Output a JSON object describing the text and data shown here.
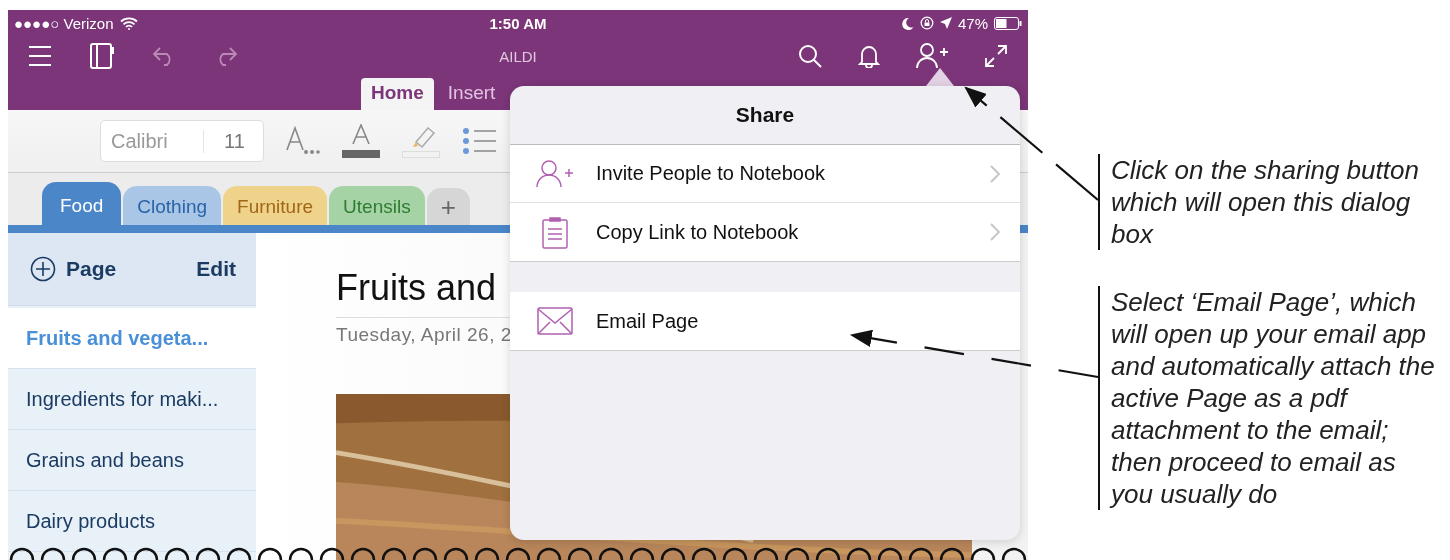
{
  "status_bar": {
    "carrier": "●●●●○ Verizon",
    "time": "1:50 AM",
    "battery": "47%"
  },
  "app_bar": {
    "title": "AILDI",
    "history": [
      {
        "kind": "undo",
        "disabled": true
      },
      {
        "kind": "redo",
        "disabled": true
      }
    ]
  },
  "ribbon_tabs": [
    {
      "label": "Home",
      "selected": true
    },
    {
      "label": "Insert",
      "selected": false
    }
  ],
  "toolbar": {
    "font": "Calibri",
    "size": "11"
  },
  "section_tabs": [
    {
      "label": "Food",
      "color": "#4a86c8",
      "selected": true
    },
    {
      "label": "Clothing",
      "color": "#a9c6e6",
      "selected": false
    },
    {
      "label": "Furniture",
      "color": "#f0d38a",
      "selected": false
    },
    {
      "label": "Utensils",
      "color": "#a6d3a6",
      "selected": false
    }
  ],
  "add_section": "+",
  "pages": {
    "add_label": "Page",
    "edit_label": "Edit",
    "items": [
      {
        "title": "Fruits and vegeta...",
        "selected": true
      },
      {
        "title": "Ingredients for maki...",
        "selected": false
      },
      {
        "title": "Grains and beans",
        "selected": false
      },
      {
        "title": "Dairy products",
        "selected": false
      }
    ]
  },
  "note": {
    "title": "Fruits and",
    "date": "Tuesday, April 26, 2"
  },
  "share_popup": {
    "title": "Share",
    "sections": [
      {
        "items": [
          {
            "kind": "invite",
            "label": "Invite People to Notebook",
            "disclosure": true
          },
          {
            "kind": "copy-link",
            "label": "Copy Link to Notebook",
            "disclosure": true
          }
        ]
      },
      {
        "items": [
          {
            "kind": "email",
            "label": "Email Page",
            "disclosure": false
          }
        ]
      }
    ]
  },
  "annotations": [
    {
      "text": "Click on the sharing button which will open this dialog box"
    },
    {
      "text": "Select ‘Email Page’, which will open up your email app and automatically attach the active Page as a pdf attachment to the email; then proceed to email as you usually do"
    }
  ]
}
